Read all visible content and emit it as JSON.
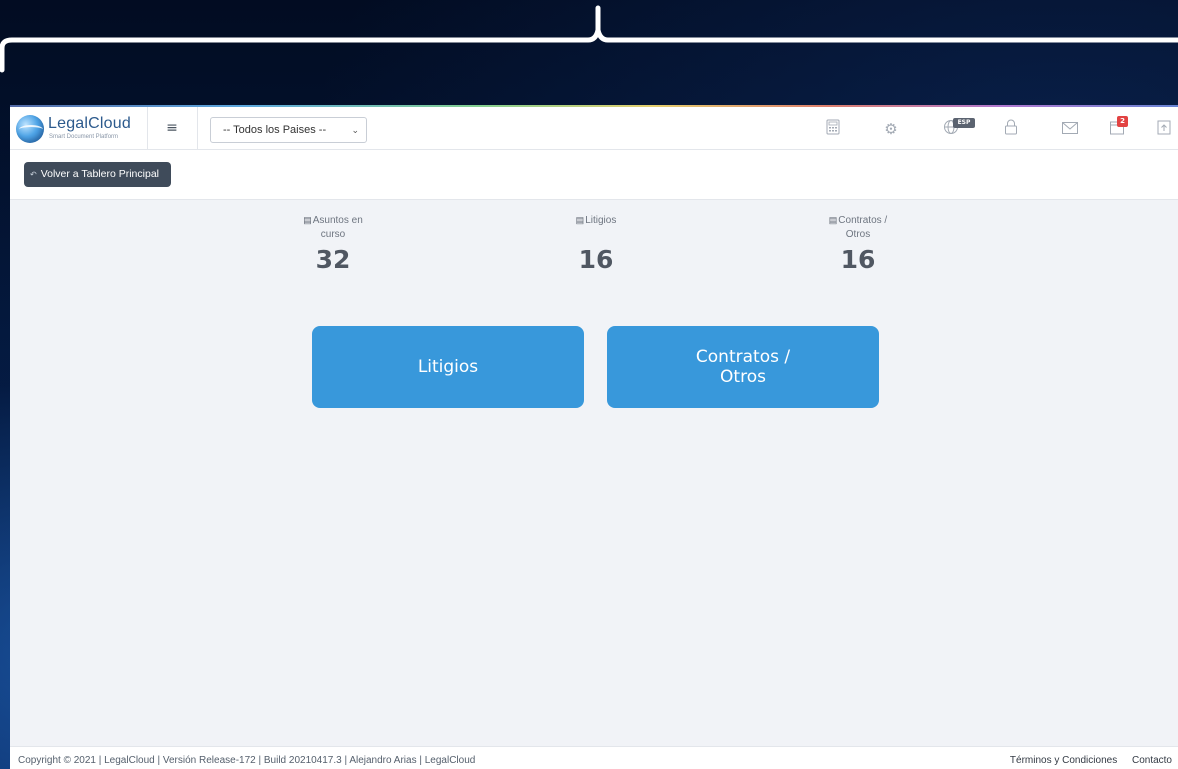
{
  "header": {
    "logo_name": "LegalCloud",
    "logo_tagline": "Smart Document Platform",
    "country_select": "-- Todos los Paises --",
    "language_badge": "ESP",
    "notification_count": "2"
  },
  "subbar": {
    "back_label": "Volver a Tablero Principal"
  },
  "stats": [
    {
      "label": "Asuntos en curso",
      "value": "32"
    },
    {
      "label": "Litigios",
      "value": "16"
    },
    {
      "label": "Contratos / Otros",
      "value": "16"
    }
  ],
  "categories": [
    {
      "label": "Litigios"
    },
    {
      "label": "Contratos / Otros"
    }
  ],
  "footer": {
    "copyright": "Copyright © 2021 | LegalCloud | Versión Release-172 | Build 20210417.3 | Alejandro Arias | LegalCloud",
    "terms": "Términos y Condiciones",
    "contact": "Contacto"
  },
  "icons": {
    "menu": "hamburger-icon",
    "calculator": "calculator-icon",
    "settings": "gear-icon",
    "language": "globe-icon",
    "lock": "lock-icon",
    "mail": "mail-icon",
    "notifications": "calendar-icon",
    "upload": "upload-icon"
  },
  "colors": {
    "accent": "#3898db",
    "dark_button": "#3f4b5a",
    "badge_red": "#e24343"
  }
}
